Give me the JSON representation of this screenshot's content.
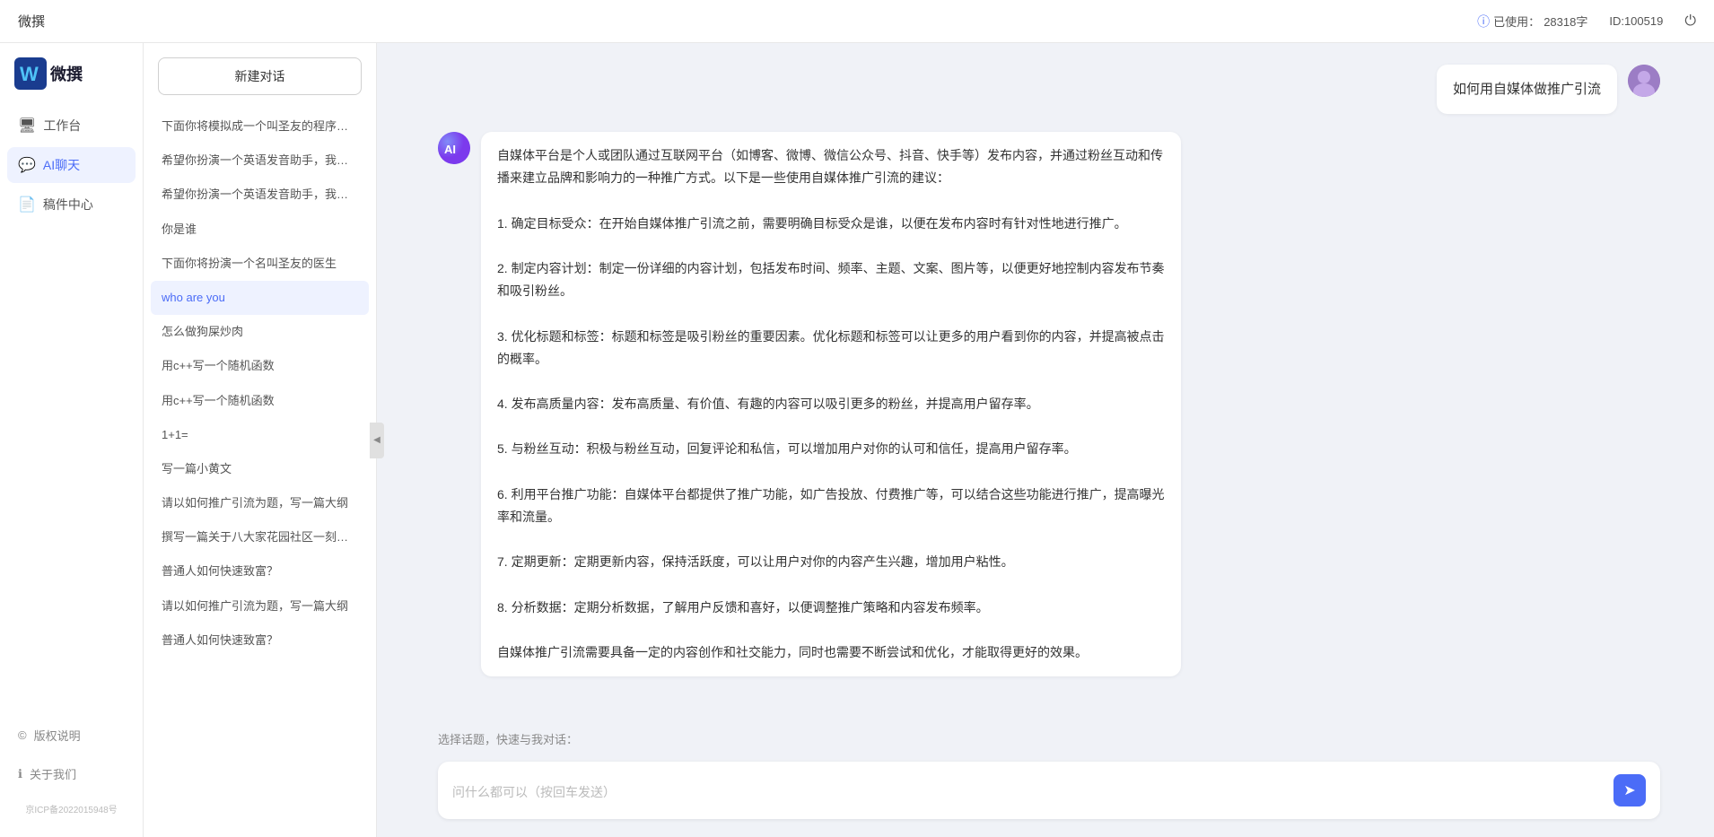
{
  "app": {
    "name": "微撰",
    "logo_letter": "W"
  },
  "topbar": {
    "title": "微撰",
    "usage_label": "已使用：",
    "usage_value": "28318字",
    "id_label": "ID:100519",
    "logout_icon": "⏻"
  },
  "sidebar": {
    "nav_items": [
      {
        "id": "workbench",
        "label": "工作台",
        "icon": "🖥"
      },
      {
        "id": "ai-chat",
        "label": "AI聊天",
        "icon": "💬",
        "active": true
      },
      {
        "id": "draft",
        "label": "稿件中心",
        "icon": "📄"
      }
    ],
    "bottom_items": [
      {
        "id": "copyright",
        "label": "版权说明",
        "icon": "©"
      },
      {
        "id": "about",
        "label": "关于我们",
        "icon": "ℹ"
      }
    ],
    "icp": "京ICP备2022015948号"
  },
  "history": {
    "new_btn": "新建对话",
    "items": [
      {
        "id": "h1",
        "text": "下面你将模拟成一个叫圣友的程序员，我说...",
        "active": false
      },
      {
        "id": "h2",
        "text": "希望你扮演一个英语发音助手，我提供给你...",
        "active": false
      },
      {
        "id": "h3",
        "text": "希望你扮演一个英语发音助手，我提供给你...",
        "active": false
      },
      {
        "id": "h4",
        "text": "你是谁",
        "active": false
      },
      {
        "id": "h5",
        "text": "下面你将扮演一个名叫圣友的医生",
        "active": false
      },
      {
        "id": "h6",
        "text": "who are you",
        "active": true
      },
      {
        "id": "h7",
        "text": "怎么做狗屎炒肉",
        "active": false
      },
      {
        "id": "h8",
        "text": "用c++写一个随机函数",
        "active": false
      },
      {
        "id": "h9",
        "text": "用c++写一个随机函数",
        "active": false
      },
      {
        "id": "h10",
        "text": "1+1=",
        "active": false
      },
      {
        "id": "h11",
        "text": "写一篇小黄文",
        "active": false
      },
      {
        "id": "h12",
        "text": "请以如何推广引流为题，写一篇大纲",
        "active": false
      },
      {
        "id": "h13",
        "text": "撰写一篇关于八大家花园社区一刻钟便民生...",
        "active": false
      },
      {
        "id": "h14",
        "text": "普通人如何快速致富？",
        "active": false
      },
      {
        "id": "h15",
        "text": "请以如何推广引流为题，写一篇大纲",
        "active": false
      },
      {
        "id": "h16",
        "text": "普通人如何快速致富？",
        "active": false
      }
    ]
  },
  "chat": {
    "messages": [
      {
        "role": "user",
        "avatar_type": "user",
        "content": "如何用自媒体做推广引流"
      },
      {
        "role": "assistant",
        "avatar_type": "ai",
        "avatar_label": "AI",
        "content": "自媒体平台是个人或团队通过互联网平台（如博客、微博、微信公众号、抖音、快手等）发布内容，并通过粉丝互动和传播来建立品牌和影响力的一种推广方式。以下是一些使用自媒体推广引流的建议：\n\n1. 确定目标受众：在开始自媒体推广引流之前，需要明确目标受众是谁，以便在发布内容时有针对性地进行推广。\n\n2. 制定内容计划：制定一份详细的内容计划，包括发布时间、频率、主题、文案、图片等，以便更好地控制内容发布节奏和吸引粉丝。\n\n3. 优化标题和标签：标题和标签是吸引粉丝的重要因素。优化标题和标签可以让更多的用户看到你的内容，并提高被点击的概率。\n\n4. 发布高质量内容：发布高质量、有价值、有趣的内容可以吸引更多的粉丝，并提高用户留存率。\n\n5. 与粉丝互动：积极与粉丝互动，回复评论和私信，可以增加用户对你的认可和信任，提高用户留存率。\n\n6. 利用平台推广功能：自媒体平台都提供了推广功能，如广告投放、付费推广等，可以结合这些功能进行推广，提高曝光率和流量。\n\n7. 定期更新：定期更新内容，保持活跃度，可以让用户对你的内容产生兴趣，增加用户粘性。\n\n8. 分析数据：定期分析数据，了解用户反馈和喜好，以便调整推广策略和内容发布频率。\n\n自媒体推广引流需要具备一定的内容创作和社交能力，同时也需要不断尝试和优化，才能取得更好的效果。"
      }
    ],
    "quick_topics_label": "选择话题，快速与我对话：",
    "input_placeholder": "问什么都可以（按回车发送）"
  }
}
